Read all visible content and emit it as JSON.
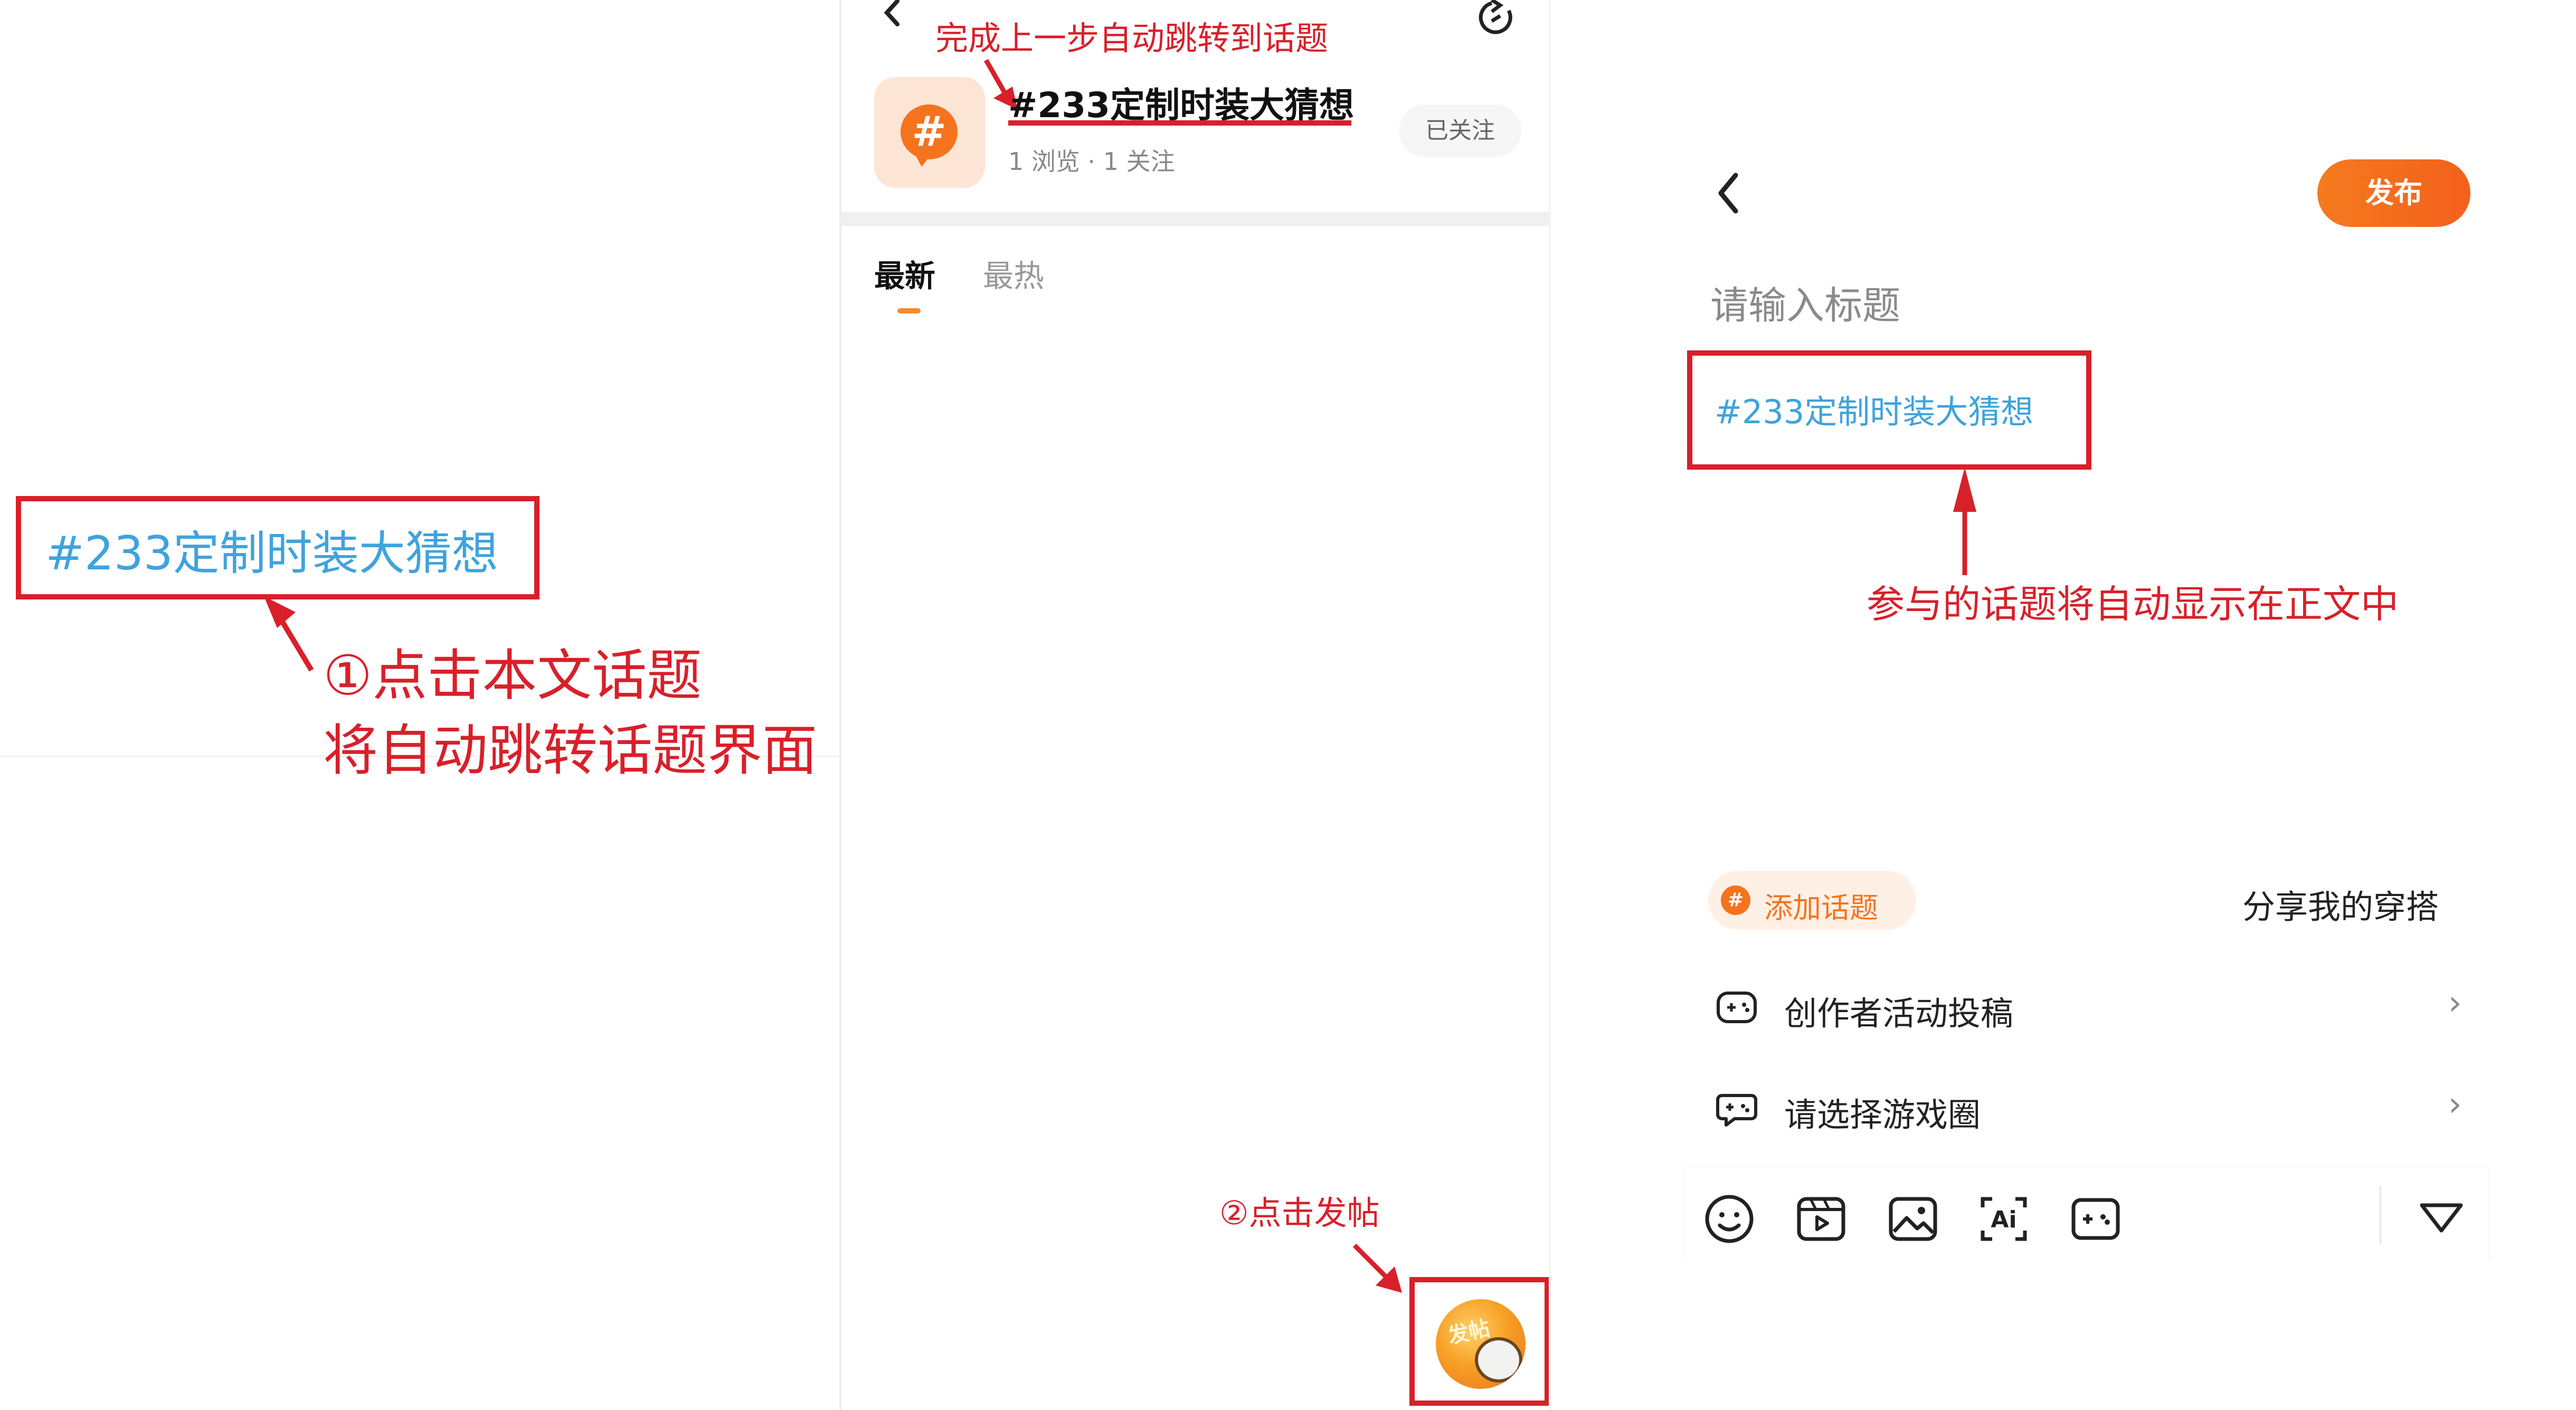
{
  "left_panel": {
    "topic_tag": "#233定制时装大猜想",
    "annotation_line1": "①点击本文话题",
    "annotation_line2": "将自动跳转话题界面"
  },
  "middle_panel": {
    "annotation_top": "完成上一步自动跳转到话题",
    "topic_title": "#233定制时装大猜想",
    "topic_stats": "1 浏览 · 1 关注",
    "follow_label": "已关注",
    "tabs": [
      {
        "label": "最新",
        "active": true
      },
      {
        "label": "最热",
        "active": false
      }
    ],
    "post_annotation": "②点击发帖",
    "post_button_label": "发帖"
  },
  "right_panel": {
    "publish_label": "发布",
    "title_placeholder": "请输入标题",
    "body_topic": "#233定制时装大猜想",
    "annotation": "参与的话题将自动显示在正文中",
    "add_topic_label": "添加话题",
    "share_outfit": "分享我的穿搭",
    "rows": [
      {
        "label": "创作者活动投稿",
        "icon": "gamepad-icon"
      },
      {
        "label": "请选择游戏圈",
        "icon": "game-circle-icon"
      }
    ],
    "toolbar_icons": [
      "emoji-icon",
      "video-icon",
      "image-icon",
      "ai-icon",
      "game-icon",
      "collapse-icon"
    ]
  },
  "colors": {
    "accent_orange": "#f5731d",
    "annotation_red": "#d8202a",
    "topic_blue": "#3fa3dc"
  }
}
